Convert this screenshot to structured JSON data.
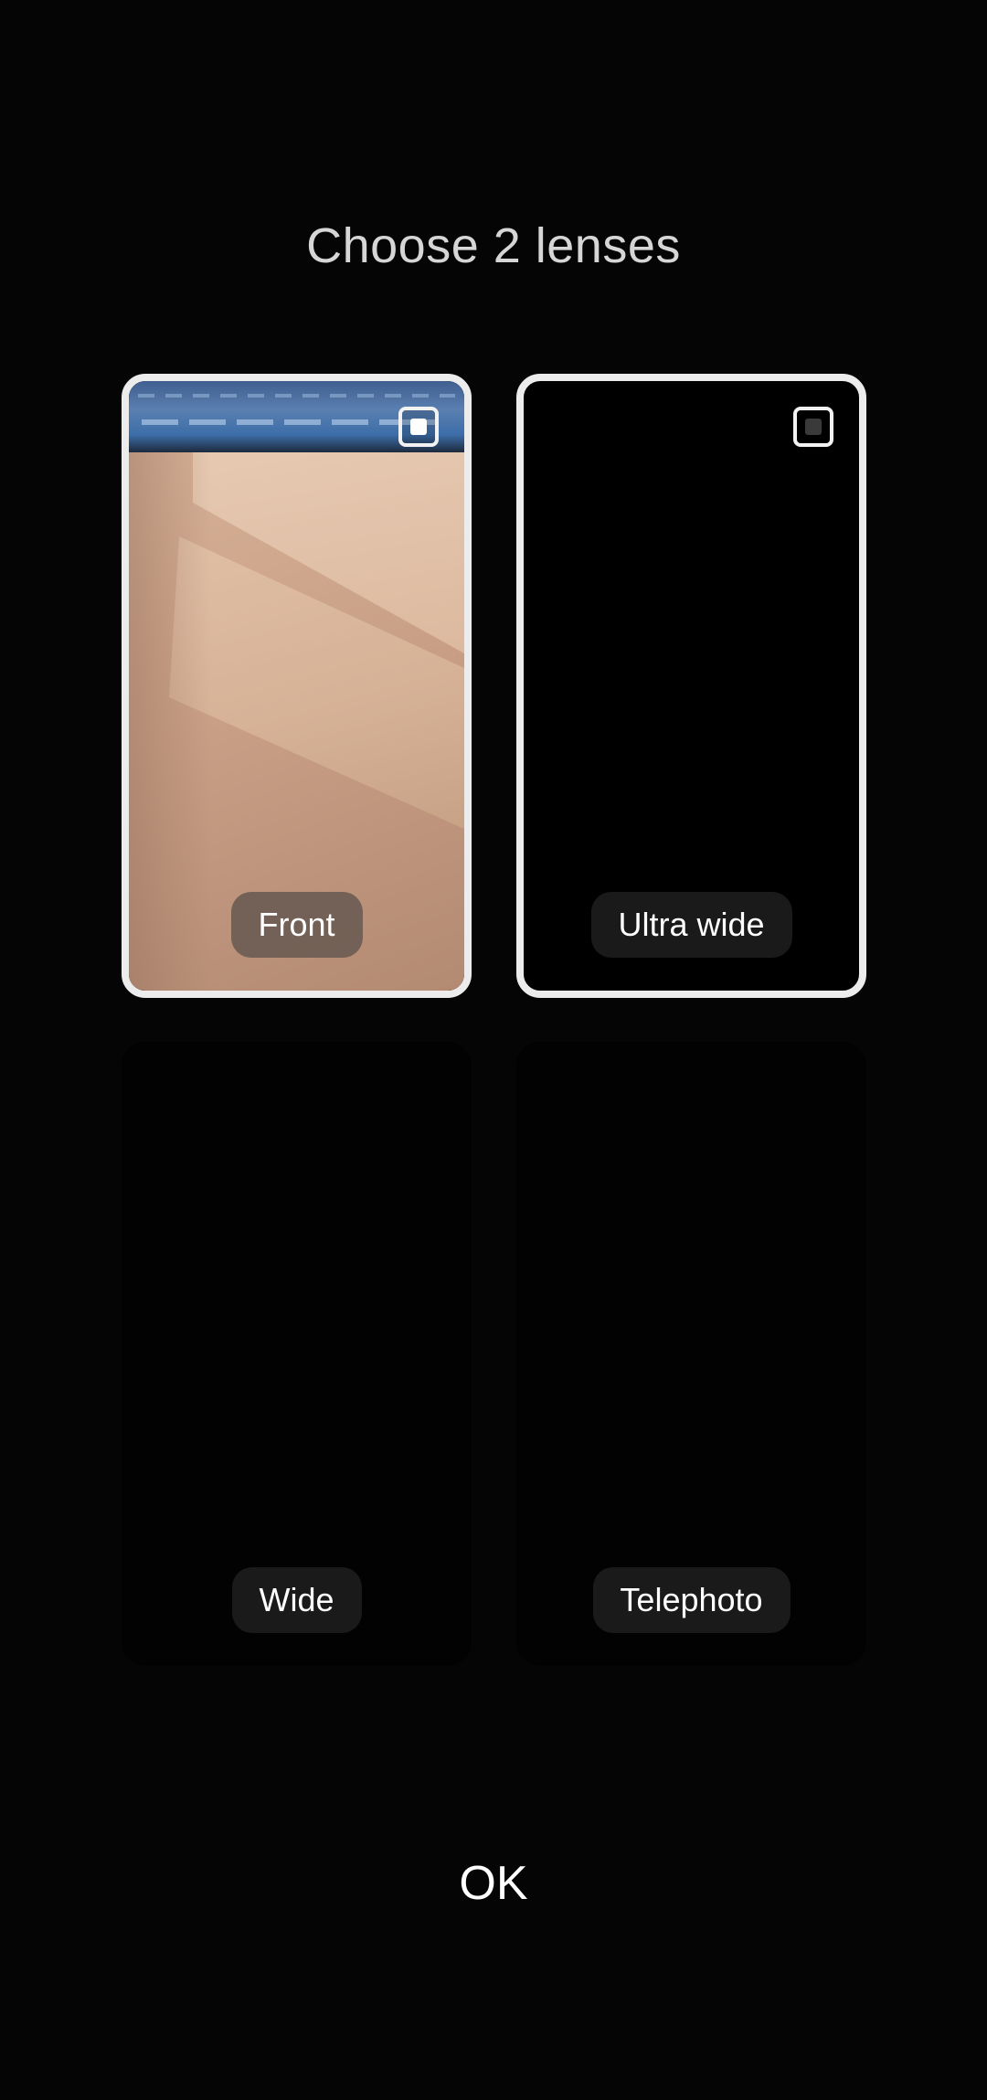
{
  "title": "Choose 2 lenses",
  "lenses": [
    {
      "label": "Front",
      "selected": true
    },
    {
      "label": "Ultra wide",
      "selected": false
    },
    {
      "label": "Wide",
      "selected": false
    },
    {
      "label": "Telephoto",
      "selected": false
    }
  ],
  "ok_label": "OK"
}
